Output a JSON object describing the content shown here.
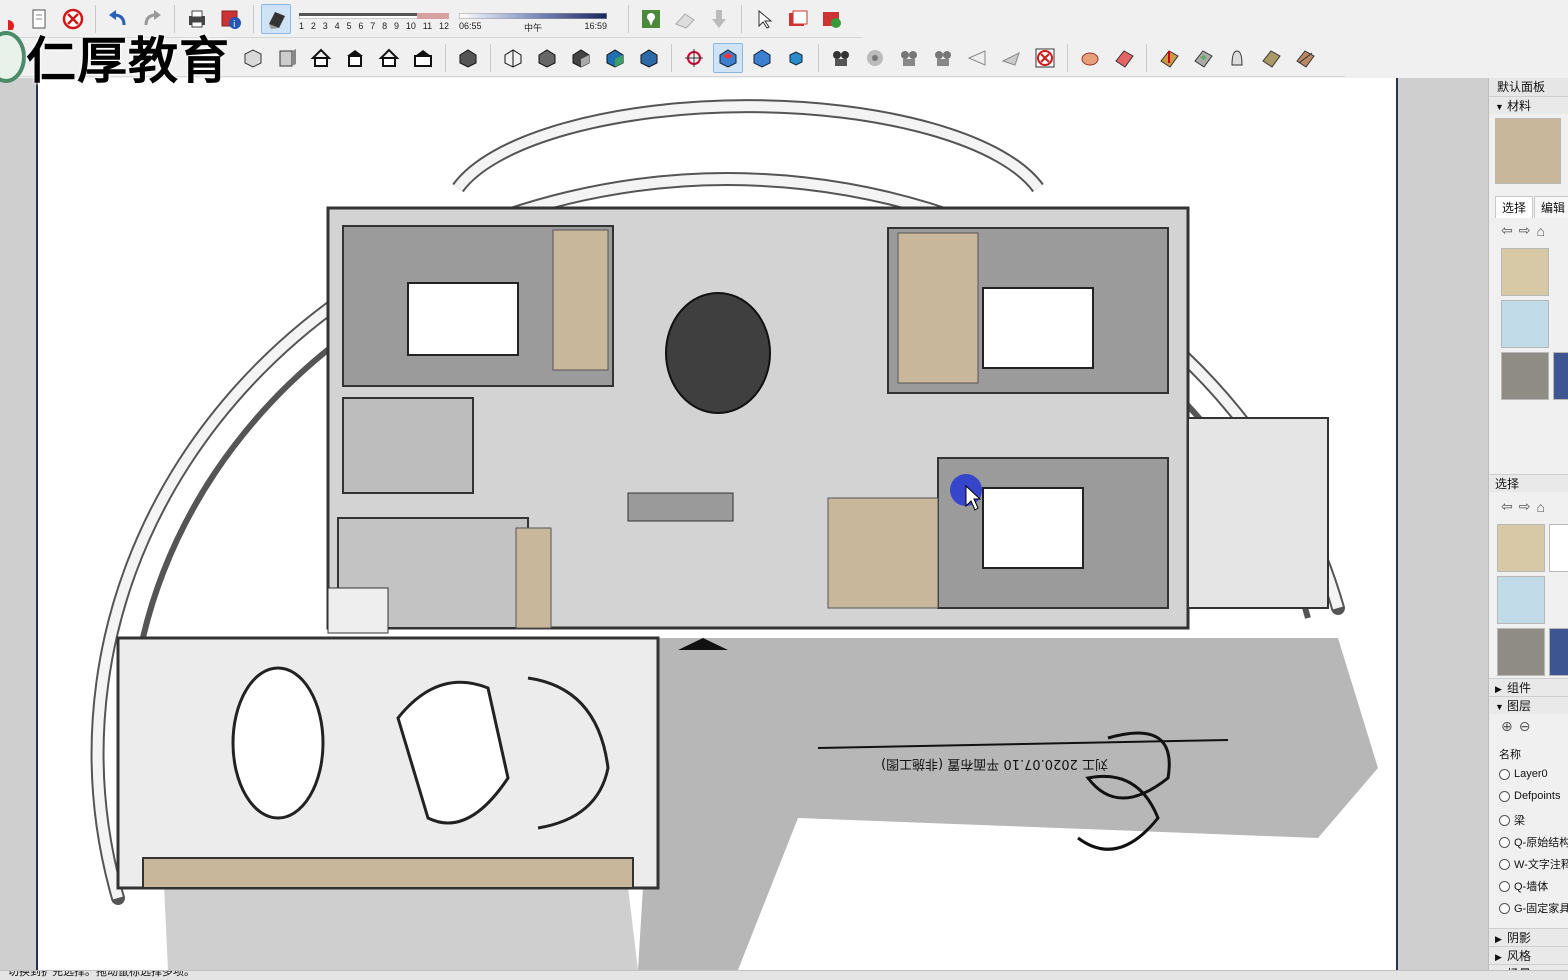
{
  "logo": {
    "text": "仁厚教育"
  },
  "toolbar": {
    "row1": [
      "eraser-tool",
      "notes-icon",
      "no-entry-icon",
      "undo-icon",
      "redo-icon",
      "print-icon",
      "model-info-icon"
    ],
    "shadow": {
      "months": [
        "1",
        "2",
        "3",
        "4",
        "5",
        "6",
        "7",
        "8",
        "9",
        "10",
        "11",
        "12"
      ],
      "time_start": "06:55",
      "time_mid": "中午",
      "time_end": "16:59"
    },
    "row1b": [
      "add-location-icon",
      "toggle-terrain-icon",
      "get-photo-icon",
      "select-arrow-icon",
      "warehouse-icon",
      "extension-icon"
    ],
    "row2": [
      "iso-view",
      "front-view",
      "top-view",
      "house-front",
      "house-right",
      "house-back",
      "house-left",
      "xray-style",
      "wireframe-style",
      "hidden-line-style",
      "shaded-style",
      "textured-style",
      "monochrome-style",
      "orbit-tool",
      "section-plane-tool",
      "display-sections",
      "section-cuts",
      "walk-tool",
      "look-around-tool",
      "position-camera",
      "zoom-window",
      "previous-view",
      "next-view",
      "no-entry-icon",
      "sandbox-from-contours",
      "sandbox-from-scratch",
      "smoove",
      "stamp",
      "drape",
      "add-detail",
      "flip-edge"
    ]
  },
  "panel": {
    "title": "默认面板",
    "materials_header": "材料",
    "tab_select": "选择",
    "tab_edit": "编辑",
    "select_label": "选择",
    "components_header": "组件",
    "layers_header": "图层",
    "name_label": "名称",
    "layers": [
      "Layer0",
      "Defpoints",
      "梁",
      "Q-原始结构",
      "W-文字注释",
      "Q-墙体",
      "G-固定家具"
    ],
    "shadows_header": "阴影",
    "styles_header": "风格",
    "scenes_header": "场景"
  },
  "colors": {
    "wood": "#c9b79b",
    "blue_tex": "#c2dbe8",
    "gray_tex": "#8f8c85",
    "navy_tex": "#3d5590",
    "sand_tex": "#d8c9a6"
  },
  "status": {
    "text": "切换到扩充选择。拖动鼠标选择多项。"
  },
  "plan": {
    "annotation": "刘工 2020.07.10 平面布置 (非施工图)"
  }
}
